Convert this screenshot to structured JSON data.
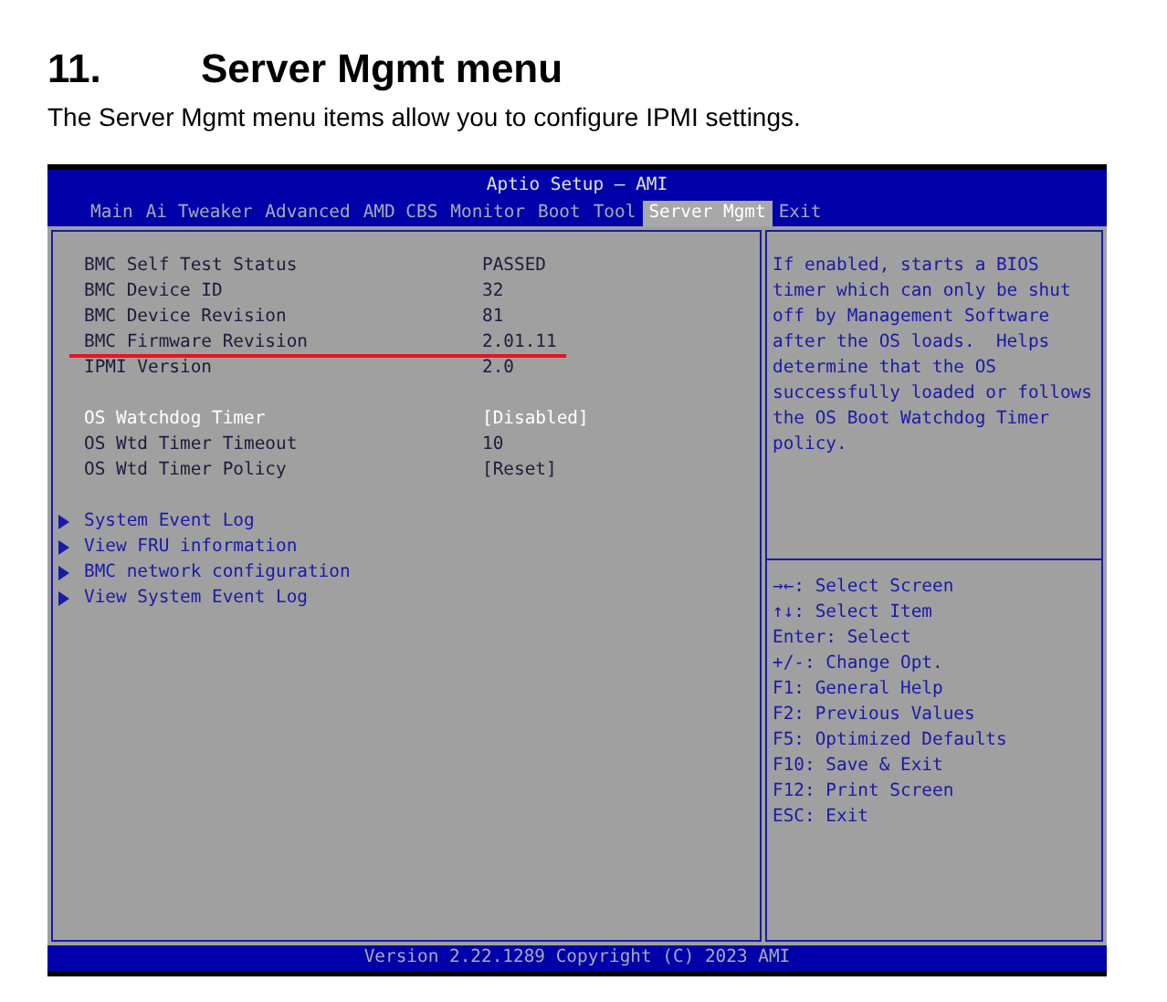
{
  "heading": {
    "number": "11.",
    "title": "Server Mgmt menu"
  },
  "intro": "The Server Mgmt menu items allow you to configure IPMI settings.",
  "bios": {
    "title": "Aptio Setup – AMI",
    "tabs": [
      {
        "label": "Main",
        "selected": false
      },
      {
        "label": "Ai Tweaker",
        "selected": false
      },
      {
        "label": "Advanced",
        "selected": false
      },
      {
        "label": "AMD CBS",
        "selected": false
      },
      {
        "label": "Monitor",
        "selected": false
      },
      {
        "label": "Boot",
        "selected": false
      },
      {
        "label": "Tool",
        "selected": false
      },
      {
        "label": "Server Mgmt",
        "selected": true
      },
      {
        "label": "Exit",
        "selected": false
      }
    ],
    "groups": [
      [
        {
          "kind": "info",
          "label": "BMC Self Test Status",
          "value": "PASSED",
          "underlined": false
        },
        {
          "kind": "info",
          "label": "BMC Device ID",
          "value": "32",
          "underlined": false
        },
        {
          "kind": "info",
          "label": "BMC Device Revision",
          "value": "81",
          "underlined": false
        },
        {
          "kind": "info",
          "label": "BMC Firmware Revision",
          "value": "2.01.11",
          "underlined": true
        },
        {
          "kind": "info",
          "label": "IPMI Version",
          "value": "2.0",
          "underlined": false
        }
      ],
      [
        {
          "kind": "setting",
          "label": "OS Watchdog Timer",
          "value": "[Disabled]",
          "selected": true
        },
        {
          "kind": "setting",
          "label": "OS Wtd Timer Timeout",
          "value": "10",
          "selected": false
        },
        {
          "kind": "setting",
          "label": "OS Wtd Timer Policy",
          "value": "[Reset]",
          "selected": false
        }
      ],
      [
        {
          "kind": "submenu",
          "label": "System Event Log"
        },
        {
          "kind": "submenu",
          "label": "View FRU information"
        },
        {
          "kind": "submenu",
          "label": "BMC network configuration"
        },
        {
          "kind": "submenu",
          "label": "View System Event Log"
        }
      ]
    ],
    "help": "If enabled, starts a BIOS timer which can only be shut off by Management Software after the OS loads.  Helps determine that the OS successfully loaded or follows the OS Boot Watchdog Timer policy.",
    "keys": [
      "→←: Select Screen",
      "↑↓: Select Item",
      "Enter: Select",
      "+/-: Change Opt.",
      "F1: General Help",
      "F2: Previous Values",
      "F5: Optimized Defaults",
      "F10: Save & Exit",
      "F12: Print Screen",
      "ESC: Exit"
    ],
    "footer": "Version 2.22.1289 Copyright (C) 2023 AMI"
  }
}
